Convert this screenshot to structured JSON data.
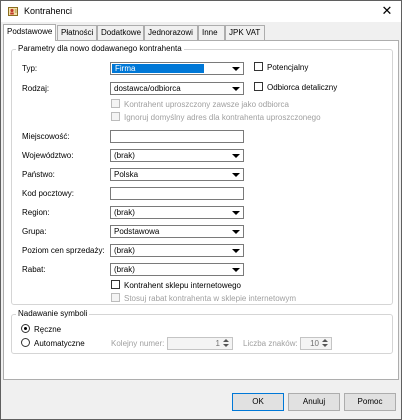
{
  "window": {
    "title": "Kontrahenci",
    "close_symbol": "✕"
  },
  "tabs": [
    {
      "label": "Podstawowe",
      "active": true
    },
    {
      "label": "Płatności",
      "active": false
    },
    {
      "label": "Dodatkowe",
      "active": false
    },
    {
      "label": "Jednorazowi",
      "active": false
    },
    {
      "label": "Inne",
      "active": false
    },
    {
      "label": "JPK VAT",
      "active": false
    }
  ],
  "params": {
    "title": "Parametry dla nowo dodawanego kontrahenta",
    "typ": {
      "label": "Typ:",
      "value": "Firma"
    },
    "rodzaj": {
      "label": "Rodzaj:",
      "value": "dostawca/odbiorca"
    },
    "potencjalny": {
      "label": "Potencjalny",
      "checked": false
    },
    "odbiorca_detaliczny": {
      "label": "Odbiorca detaliczny",
      "checked": false
    },
    "uproszczony": {
      "label": "Kontrahent uproszczony zawsze jako odbiorca",
      "checked": false,
      "enabled": false
    },
    "ignoruj": {
      "label": "Ignoruj domyślny adres dla kontrahenta uproszczonego",
      "checked": false,
      "enabled": false
    },
    "miejscowosc": {
      "label": "Miejscowość:",
      "value": ""
    },
    "wojewodztwo": {
      "label": "Województwo:",
      "value": "(brak)"
    },
    "panstwo": {
      "label": "Państwo:",
      "value": "Polska"
    },
    "kod": {
      "label": "Kod pocztowy:",
      "value": ""
    },
    "region": {
      "label": "Region:",
      "value": "(brak)"
    },
    "grupa": {
      "label": "Grupa:",
      "value": "Podstawowa"
    },
    "poziom": {
      "label": "Poziom cen sprzedaży:",
      "value": "(brak)"
    },
    "rabat": {
      "label": "Rabat:",
      "value": "(brak)"
    },
    "sklep": {
      "label": "Kontrahent sklepu internetowego",
      "checked": false
    },
    "stosuj": {
      "label": "Stosuj rabat kontrahenta w sklepie internetowym",
      "checked": false,
      "enabled": false
    }
  },
  "symbols": {
    "title": "Nadawanie symboli",
    "reczne": {
      "label": "Ręczne",
      "selected": true
    },
    "auto": {
      "label": "Automatyczne",
      "selected": false
    },
    "kolejny": {
      "label": "Kolejny numer:",
      "value": "1"
    },
    "liczba": {
      "label": "Liczba znaków:",
      "value": "10"
    }
  },
  "buttons": {
    "ok": "OK",
    "cancel": "Anuluj",
    "help": "Pomoc"
  },
  "colors": {
    "selection": "#0078d7",
    "default_button_border": "#0078d7"
  },
  "icons": {
    "app": "contacts-icon",
    "close": "close-icon",
    "dropdown": "chevron-down-icon"
  }
}
